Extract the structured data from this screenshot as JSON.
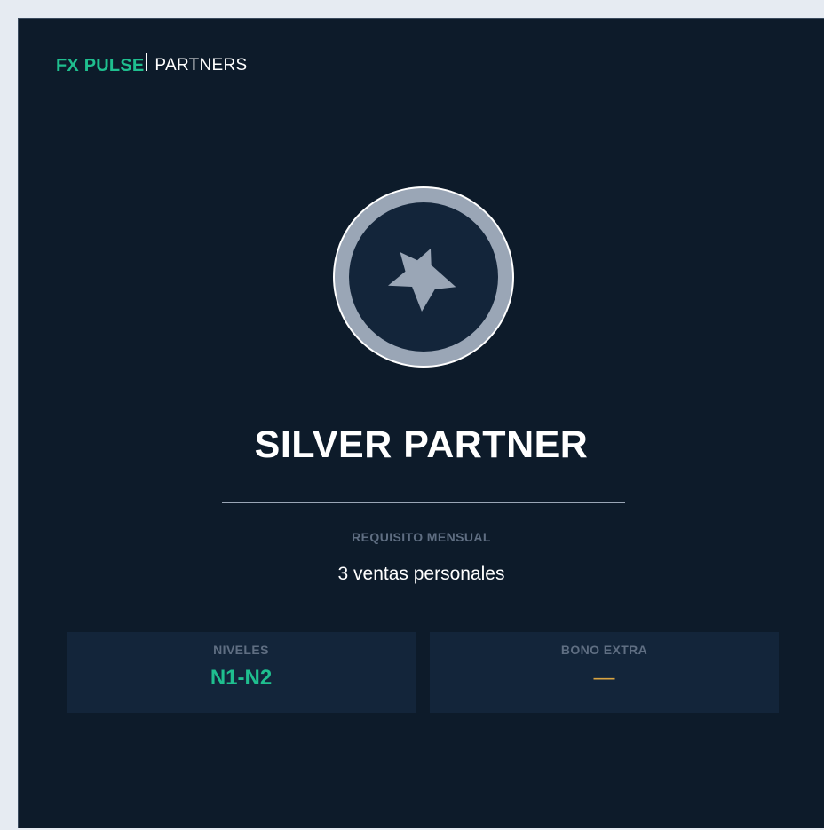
{
  "brand": {
    "primary": "FX PULSE",
    "secondary": "PARTNERS",
    "primary_color": "#1fbf8f"
  },
  "badge": {
    "icon": "star-icon",
    "ring_color": "#9aa6b6"
  },
  "tier": {
    "name": "SILVER PARTNER"
  },
  "requirement": {
    "label": "REQUISITO MENSUAL",
    "value": "3 ventas personales"
  },
  "stats": [
    {
      "label": "NIVELES",
      "value": "N1-N2",
      "color": "#1fbf8f"
    },
    {
      "label": "BONO EXTRA",
      "value": "—",
      "color": "#d9a441"
    }
  ]
}
